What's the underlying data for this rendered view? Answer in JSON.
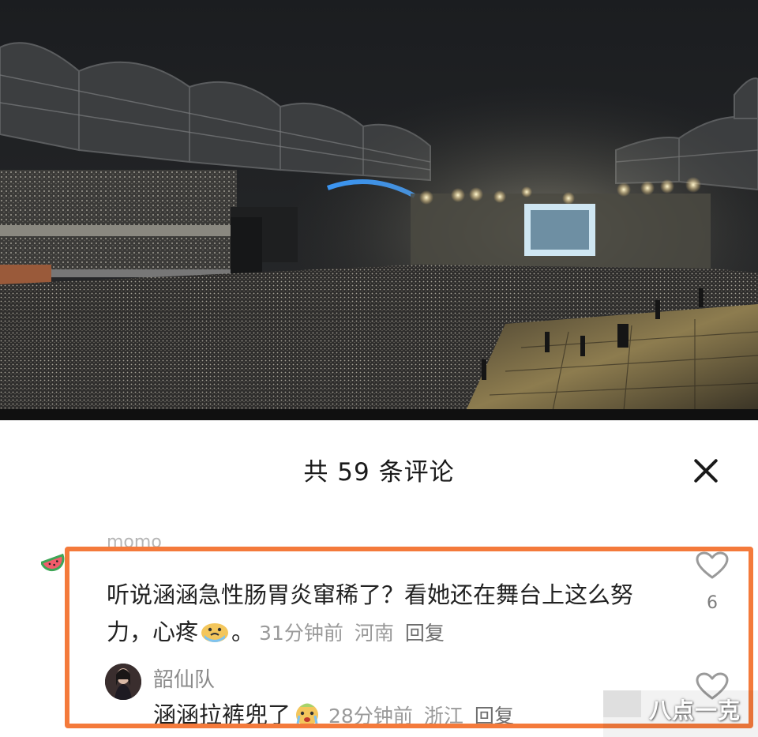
{
  "photo": {
    "description_icon": "concert-stadium-photo"
  },
  "comments_panel": {
    "title": "共 59 条评论",
    "close_icon": "close-icon"
  },
  "comment": {
    "username": "momo",
    "text": "听说涵涵急性肠胃炎窜稀了？看她还在舞台上这么努力，心疼",
    "text_suffix": "。",
    "emoji": "crying-face-emoji",
    "time": "31分钟前",
    "location": "河南",
    "reply_label": "回复",
    "like_icon": "heart-outline-icon",
    "like_count": "6"
  },
  "reply": {
    "username": "韶仙队",
    "text": "涵涵拉裤兜了",
    "emoji": "crying-face-emoji",
    "time": "28分钟前",
    "location": "浙江",
    "reply_label": "回复",
    "like_icon": "heart-outline-icon"
  },
  "highlight_color": "#f47a3b",
  "watermark": {
    "text": "八点一克"
  }
}
